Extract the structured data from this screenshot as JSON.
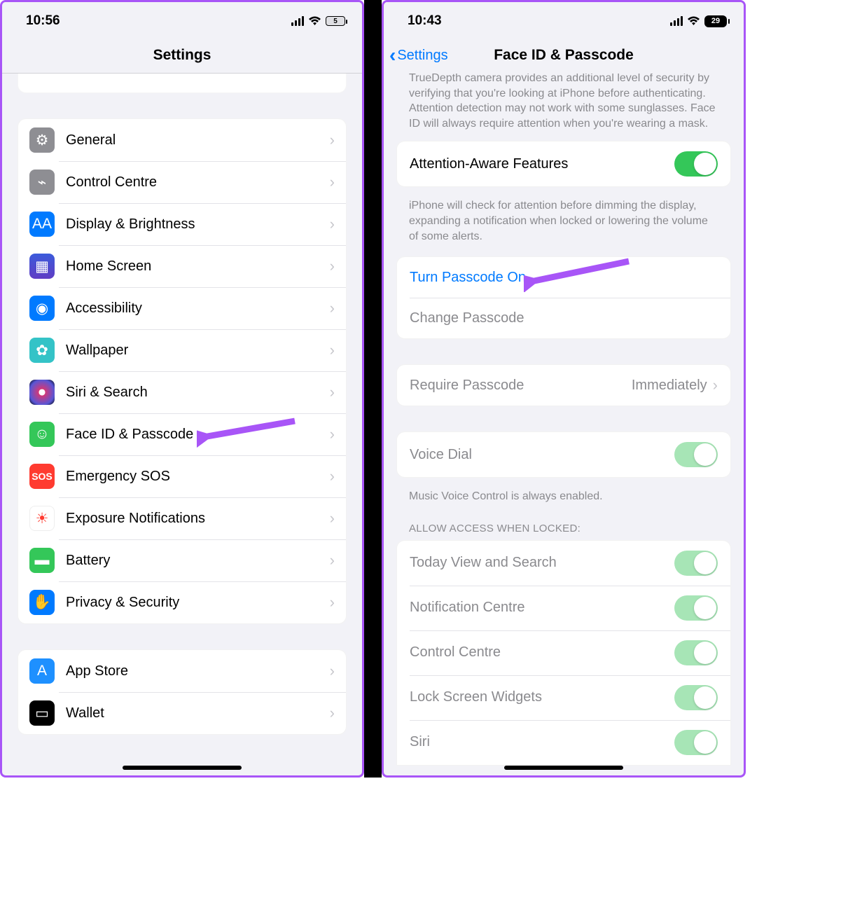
{
  "left": {
    "status": {
      "time": "10:56",
      "battery": "5"
    },
    "nav": {
      "title": "Settings"
    },
    "items": [
      {
        "label": "General",
        "icon": "gear"
      },
      {
        "label": "Control Centre",
        "icon": "control"
      },
      {
        "label": "Display & Brightness",
        "icon": "display"
      },
      {
        "label": "Home Screen",
        "icon": "home"
      },
      {
        "label": "Accessibility",
        "icon": "acc"
      },
      {
        "label": "Wallpaper",
        "icon": "wall"
      },
      {
        "label": "Siri & Search",
        "icon": "siri"
      },
      {
        "label": "Face ID & Passcode",
        "icon": "face"
      },
      {
        "label": "Emergency SOS",
        "icon": "sos"
      },
      {
        "label": "Exposure Notifications",
        "icon": "exp"
      },
      {
        "label": "Battery",
        "icon": "batt"
      },
      {
        "label": "Privacy & Security",
        "icon": "priv"
      }
    ],
    "items2": [
      {
        "label": "App Store",
        "icon": "appstore"
      },
      {
        "label": "Wallet",
        "icon": "wallet"
      }
    ]
  },
  "right": {
    "status": {
      "time": "10:43",
      "battery": "29"
    },
    "nav": {
      "back": "Settings",
      "title": "Face ID & Passcode"
    },
    "truncated_top": "TrueDepth camera provides an additional level of security by verifying that you're looking at iPhone before authenticating. Attention detection may not work with some sunglasses. Face ID will always require attention when you're wearing a mask.",
    "attention": {
      "label": "Attention-Aware Features"
    },
    "attention_footer": "iPhone will check for attention before dimming the display, expanding a notification when locked or lowering the volume of some alerts.",
    "passcode": {
      "turn_on": "Turn Passcode On",
      "change": "Change Passcode"
    },
    "require": {
      "label": "Require Passcode",
      "value": "Immediately"
    },
    "voice": {
      "label": "Voice Dial"
    },
    "voice_footer": "Music Voice Control is always enabled.",
    "allow_header": "ALLOW ACCESS WHEN LOCKED:",
    "allow_items": [
      "Today View and Search",
      "Notification Centre",
      "Control Centre",
      "Lock Screen Widgets",
      "Siri"
    ]
  }
}
